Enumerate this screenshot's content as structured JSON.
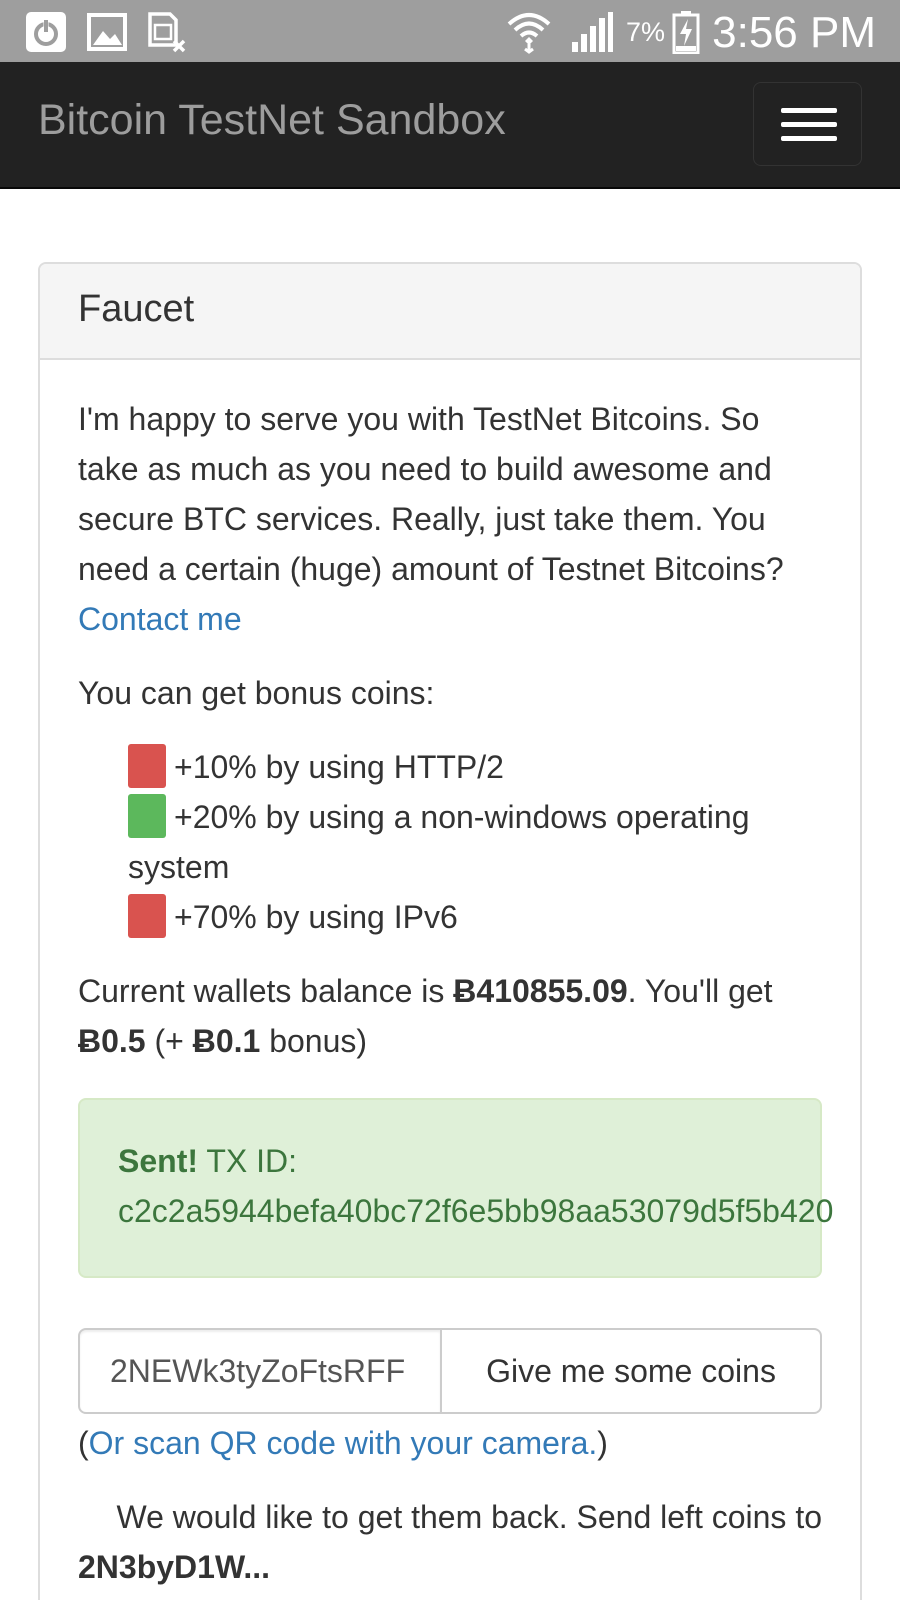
{
  "statusbar": {
    "battery_percent": "7%",
    "time": "3:56 PM",
    "left_icons": [
      "power-icon",
      "image-icon",
      "sim-blocked-icon"
    ],
    "right_icons": [
      "wifi-icon",
      "signal-icon",
      "battery-charging-icon"
    ]
  },
  "navbar": {
    "brand": "Bitcoin TestNet Sandbox",
    "menu_icon": "hamburger-menu-icon"
  },
  "panel": {
    "title": "Faucet",
    "intro_text": "I'm happy to serve you with TestNet Bitcoins. So take as much as you need to build awesome and secure BTC services. Really, just take them. You need a certain (huge) amount of Testnet Bitcoins?",
    "contact_link": "Contact me",
    "bonus_label": "You can get bonus coins:",
    "bonuses": [
      {
        "text": "+10% by using HTTP/2",
        "status": "red"
      },
      {
        "text": "+20% by using a non-windows operating system",
        "status": "green"
      },
      {
        "text": "+70% by using IPv6",
        "status": "red"
      }
    ],
    "balance": {
      "prefix": "Current wallets balance is ",
      "amount": "Ƀ410855.09",
      "middle": ". You'll get ",
      "get_amount": "Ƀ0.5",
      "bonus_prefix": " (+ ",
      "bonus_amount": "Ƀ0.1",
      "suffix": " bonus)"
    },
    "alert": {
      "strong": "Sent!",
      "label": " TX ID:",
      "txid": "c2c2a5944befa40bc72f6e5bb98aa53079d5f5b420"
    },
    "address_input_value": "2NEWk3tyZoFtsRFF",
    "give_button": "Give me some coins",
    "scan_open": "(",
    "scan_link": "Or scan QR code with your camera.",
    "scan_close": ")",
    "sendback_text": "We would like to get them back. Send left coins to",
    "return_address_partial": "2N3byD1W..."
  },
  "colors": {
    "statusbar_bg": "#9e9e9e",
    "navbar_bg": "#222222",
    "link": "#337ab7",
    "success_bg": "#dff0d8",
    "success_text": "#3c763d",
    "bonus_red": "#d9534f",
    "bonus_green": "#5cb85c"
  }
}
